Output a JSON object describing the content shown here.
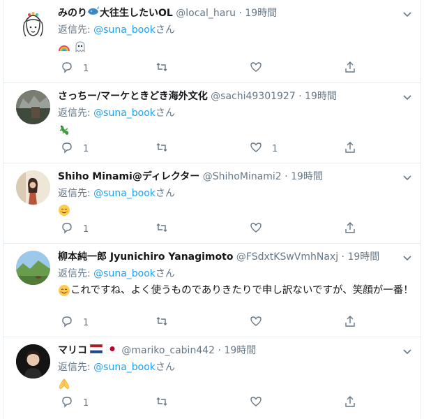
{
  "replying_label": "返信先:",
  "replying_target": "@suna_book",
  "replying_suffix": "さん",
  "tweets": [
    {
      "name": "みのり",
      "name_suffix": "大往生したいOL",
      "handle": "@local_haru",
      "dot": "·",
      "time": "19時間",
      "text": "",
      "reply_count": "1",
      "retweet_count": "",
      "like_count": "",
      "emojis": [
        "rainbow",
        "ghost"
      ]
    },
    {
      "name": "さっちー/マーケときどき海外文化",
      "name_suffix": "",
      "handle": "@sachi49301927",
      "dot": "·",
      "time": "19時間",
      "text": "",
      "reply_count": "1",
      "retweet_count": "",
      "like_count": "1",
      "emojis": [
        "lizard"
      ]
    },
    {
      "name": "Shiho Minami@ディレクター",
      "name_suffix": "",
      "handle": "@ShihoMinami2",
      "dot": "·",
      "time": "19時間",
      "text": "",
      "reply_count": "1",
      "retweet_count": "",
      "like_count": "",
      "emojis": [
        "relieved-face"
      ]
    },
    {
      "name": "柳本純一郎 Jyunichiro Yanagimoto",
      "name_suffix": "",
      "handle": "@FSdxtKSwVmhNaxj",
      "dot": "·",
      "time": "19時間",
      "text": "これですね、よく使うものでありきたりで申し訳ないですが、笑顔が一番！",
      "reply_count": "1",
      "retweet_count": "",
      "like_count": "",
      "emojis": [
        "smiling-face"
      ]
    },
    {
      "name": "マリコ",
      "name_suffix": "",
      "handle": "@mariko_cabin442",
      "dot": "·",
      "time": "19時間",
      "text": "",
      "reply_count": "1",
      "retweet_count": "",
      "like_count": "",
      "emojis": [
        "folded-hands"
      ]
    }
  ],
  "colors": {
    "accent": "#1da1f2",
    "muted": "#657786",
    "text": "#14171a",
    "border": "#e6ecf0"
  }
}
